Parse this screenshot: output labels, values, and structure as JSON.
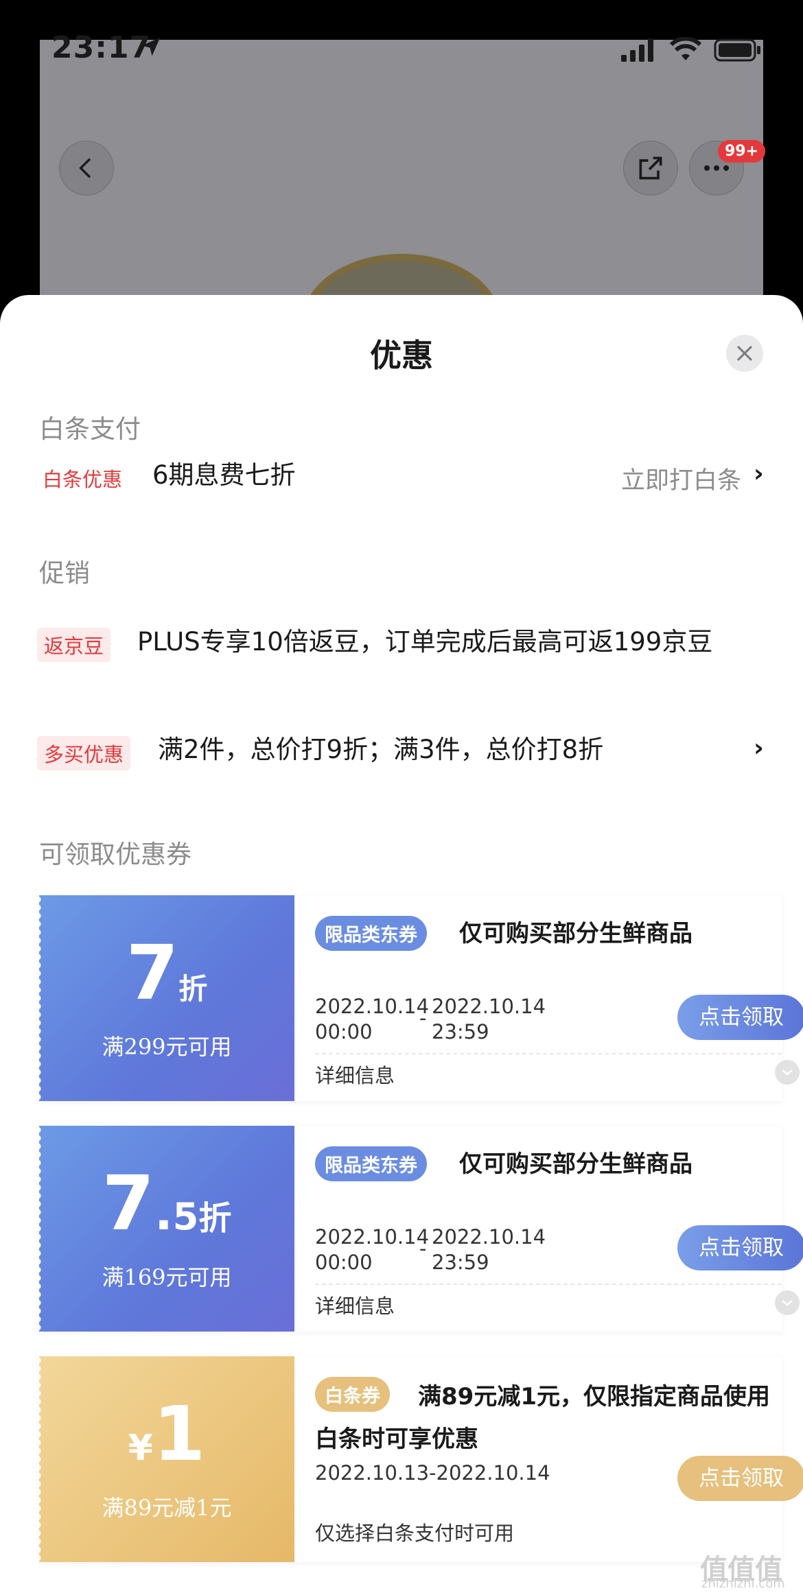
{
  "status_bar": {
    "time": "23:17"
  },
  "top_bar": {
    "badge": "99+"
  },
  "sheet": {
    "title": "优惠"
  },
  "baitiao": {
    "section_title": "白条支付",
    "tag": "白条优惠",
    "text": "6期息费七折",
    "link": "立即打白条",
    "chevron": "›"
  },
  "promo": {
    "section_title": "促销",
    "items": [
      {
        "tag": "返京豆",
        "text": "PLUS专享10倍返豆，订单完成后最高可返199京豆"
      },
      {
        "tag": "多买优惠",
        "text": "满2件，总价打9折；满3件，总价打8折",
        "chevron": "›"
      }
    ]
  },
  "coupons": {
    "section_title": "可领取优惠券",
    "items": [
      {
        "value_main": "7",
        "value_unit": "折",
        "condition": "满299元可用",
        "tag": "限品类东券",
        "title": "仅可购买部分生鲜商品",
        "date_start": "2022.10.14",
        "time_start": "00:00",
        "date_sep": "-",
        "date_end": "2022.10.14",
        "time_end": "23:59",
        "button": "点击领取",
        "detail": "详细信息"
      },
      {
        "value_main": "7",
        "value_dot": ".",
        "value_decimal": "5",
        "value_unit": "折",
        "condition": "满169元可用",
        "tag": "限品类东券",
        "title": "仅可购买部分生鲜商品",
        "date_start": "2022.10.14",
        "time_start": "00:00",
        "date_sep": "-",
        "date_end": "2022.10.14",
        "time_end": "23:59",
        "button": "点击领取",
        "detail": "详细信息"
      },
      {
        "value_currency": "¥",
        "value_main": "1",
        "condition": "满89元减1元",
        "tag": "白条券",
        "title": "满89元减1元，仅限指定商品使用白条时可享优惠",
        "date_range": "2022.10.13-2022.10.14",
        "button": "点击领取",
        "detail": "仅选择白条支付时可用"
      }
    ]
  },
  "watermark": {
    "logo": "值值值",
    "url": "zhizhizhi.com"
  },
  "colors": {
    "accent_red": "#e4393c",
    "coupon_blue": "#5f78da",
    "coupon_gold": "#e6b868"
  }
}
